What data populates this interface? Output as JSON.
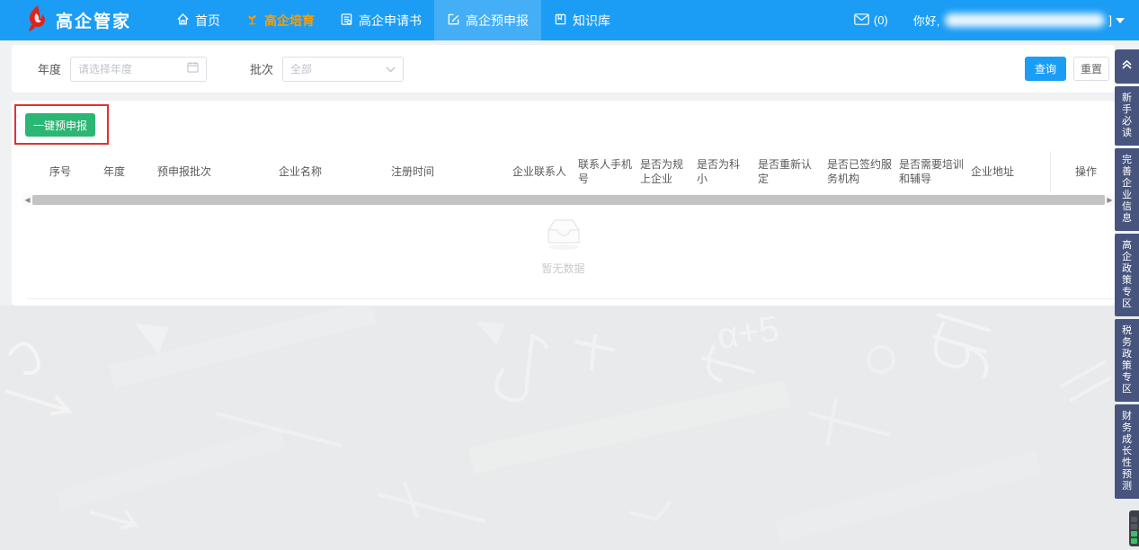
{
  "header": {
    "logo_text": "高企管家",
    "nav_items": [
      "首页",
      "高企培育",
      "高企申请书",
      "高企预申报",
      "知识库"
    ],
    "message_count": "(0)",
    "greeting": "你好,",
    "name_suffix": "]"
  },
  "filter": {
    "year_label": "年度",
    "year_placeholder": "请选择年度",
    "batch_label": "批次",
    "batch_value": "全部",
    "search_button": "查询",
    "reset_button": "重置"
  },
  "actions": {
    "one_click_prefile": "一键预申报"
  },
  "table": {
    "columns": [
      "序号",
      "年度",
      "预申报批次",
      "企业名称",
      "注册时间",
      "企业联系人",
      "联系人手机号",
      "是否为规\n上企业",
      "是否为科\n小",
      "是否重新认定",
      "是否已签约服\n务机构",
      "是否需要培训\n和辅导",
      "企业地址",
      "操作"
    ],
    "empty_text": "暂无数据"
  },
  "side_tabs": {
    "items": [
      "新手必读",
      "完善企业信息",
      "高企政策专区",
      "税务政策专区",
      "财务成长性预测"
    ]
  },
  "background": {
    "doodle_text": "α+5"
  },
  "colors": {
    "nav_blue": "#1b9df5",
    "nav_active_overlay": "rgba(255,255,255,0.18)",
    "highlight_orange": "#ff9c00",
    "button_green": "#2bb673",
    "annotation_red": "#e43030",
    "sidebar_navy": "#47557e",
    "logo_red": "#d9261c"
  }
}
